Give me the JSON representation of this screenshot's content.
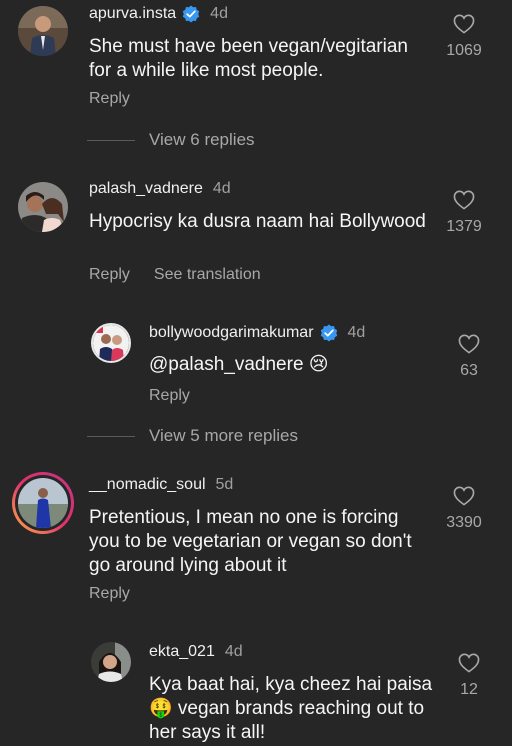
{
  "comments": [
    {
      "username": "apurva.insta",
      "verified": true,
      "age": "4d",
      "text": "She must have been vegan/vegitarian for a while like most people.",
      "likes": "1069",
      "reply_label": "Reply",
      "view_replies": "View 6 replies"
    },
    {
      "username": "palash_vadnere",
      "age": "4d",
      "text": "Hypocrisy ka dusra naam hai Bollywood",
      "likes": "1379",
      "reply_label": "Reply",
      "translate_label": "See translation"
    },
    {
      "username": "bollywoodgarimakumar",
      "verified": true,
      "age": "4d",
      "text": "@palash_vadnere 😢",
      "likes": "63",
      "reply_label": "Reply",
      "view_replies": "View 5 more replies"
    },
    {
      "username": "__nomadic_soul",
      "age": "5d",
      "text": "Pretentious, I mean no one is forcing you to be vegetarian or vegan so don't go around lying about it",
      "likes": "3390",
      "reply_label": "Reply"
    },
    {
      "username": "ekta_021",
      "age": "4d",
      "text": "Kya baat hai, kya cheez hai paisa🤑 vegan brands reaching out to her says it all!",
      "likes": "12"
    }
  ],
  "colors": {
    "background": "#262626",
    "verified_blue": "#3897f0",
    "secondary_text": "#a8a8a8",
    "story_ring_start": "#c13584",
    "story_ring_end": "#fcaf45"
  },
  "icons": {
    "like": "heart-outline-icon",
    "verified": "verified-badge-icon"
  }
}
